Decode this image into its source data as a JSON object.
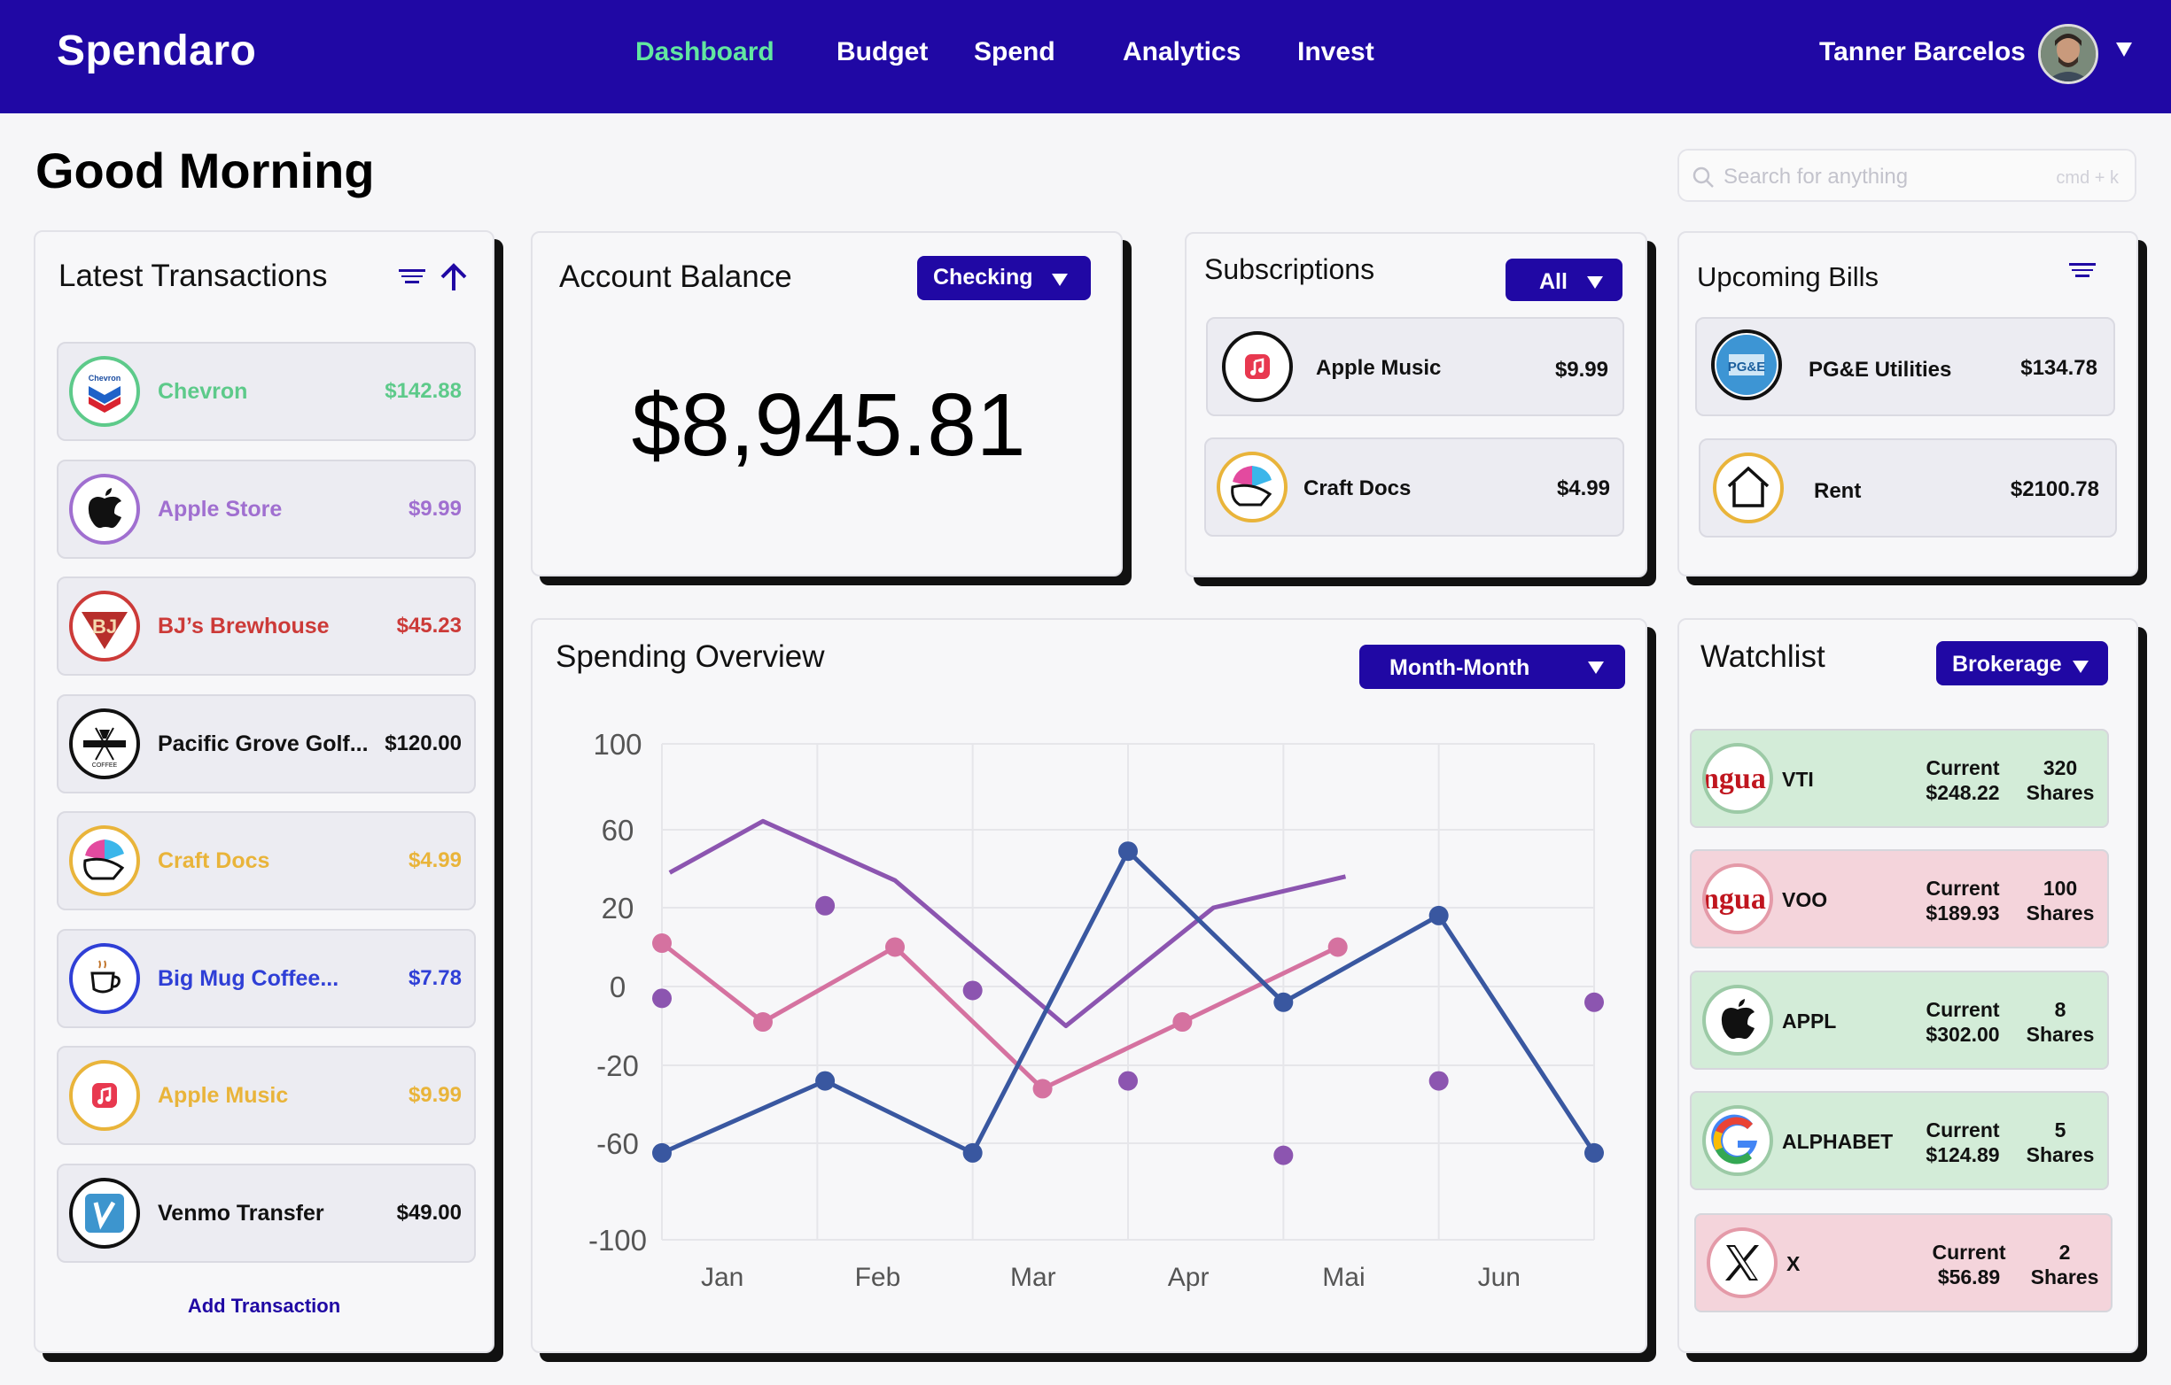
{
  "app": {
    "brand": "Spendaro"
  },
  "nav": [
    {
      "label": "Dashboard",
      "active": true
    },
    {
      "label": "Budget",
      "active": false
    },
    {
      "label": "Spend",
      "active": false
    },
    {
      "label": "Analytics",
      "active": false
    },
    {
      "label": "Invest",
      "active": false
    }
  ],
  "user": {
    "name": "Tanner Barcelos"
  },
  "greeting": "Good Morning",
  "search": {
    "placeholder": "Search for anything",
    "shortcut": "cmd + k"
  },
  "colors": {
    "brand": "#2008a4",
    "active_nav": "#62e6a0",
    "page_bg": "#f6f6f8"
  },
  "transactions": {
    "title": "Latest Transactions",
    "add_label": "Add Transaction",
    "items": [
      {
        "name": "Chevron",
        "amount": "$142.88",
        "color": "#5dca8a",
        "icon": "chevron-logo"
      },
      {
        "name": "Apple Store",
        "amount": "$9.99",
        "color": "#a06fd0",
        "icon": "apple-logo"
      },
      {
        "name": "BJ’s Brewhouse",
        "amount": "$45.23",
        "color": "#cc3a38",
        "icon": "bjs-logo"
      },
      {
        "name": "Pacific Grove Golf...",
        "amount": "$120.00",
        "color": "#111111",
        "icon": "golf-logo"
      },
      {
        "name": "Craft Docs",
        "amount": "$4.99",
        "color": "#e9b43a",
        "icon": "craft-docs-logo"
      },
      {
        "name": "Big Mug Coffee...",
        "amount": "$7.78",
        "color": "#2f3fd6",
        "icon": "coffee-logo"
      },
      {
        "name": "Apple Music",
        "amount": "$9.99",
        "color": "#e9b43a",
        "icon": "apple-music-logo"
      },
      {
        "name": "Venmo Transfer",
        "amount": "$49.00",
        "color": "#111111",
        "icon": "venmo-logo"
      }
    ]
  },
  "balance": {
    "title": "Account Balance",
    "account": "Checking",
    "amount": "$8,945.81"
  },
  "subscriptions": {
    "title": "Subscriptions",
    "filter": "All",
    "items": [
      {
        "name": "Apple Music",
        "amount": "$9.99",
        "icon": "apple-music-logo"
      },
      {
        "name": "Craft Docs",
        "amount": "$4.99",
        "icon": "craft-docs-logo"
      }
    ]
  },
  "bills": {
    "title": "Upcoming Bills",
    "items": [
      {
        "name": "PG&E Utilities",
        "amount": "$134.78",
        "icon": "pge-logo"
      },
      {
        "name": "Rent",
        "amount": "$2100.78",
        "icon": "house-icon"
      }
    ]
  },
  "spending": {
    "title": "Spending Overview",
    "period": "Month-Month"
  },
  "watchlist": {
    "title": "Watchlist",
    "account": "Brokerage",
    "current_label": "Current",
    "shares_label": "Shares",
    "items": [
      {
        "symbol": "VTI",
        "price": "$248.22",
        "shares": "320",
        "status": "up",
        "icon": "vanguard-logo",
        "logo_text": "ngua"
      },
      {
        "symbol": "VOO",
        "price": "$189.93",
        "shares": "100",
        "status": "down",
        "icon": "vanguard-logo",
        "logo_text": "ngua"
      },
      {
        "symbol": "APPL",
        "price": "$302.00",
        "shares": "8",
        "status": "up",
        "icon": "apple-logo"
      },
      {
        "symbol": "ALPHABET",
        "price": "$124.89",
        "shares": "5",
        "status": "up",
        "icon": "google-logo"
      },
      {
        "symbol": "X",
        "price": "$56.89",
        "shares": "2",
        "status": "down",
        "icon": "x-logo"
      }
    ]
  },
  "chart_data": {
    "type": "line",
    "categories": [
      "Jan",
      "Feb",
      "Mar",
      "Apr",
      "Mai",
      "Jun"
    ],
    "y_ticks": [
      100,
      60,
      20,
      0,
      -20,
      -60,
      -100
    ],
    "grid": true,
    "series": [
      {
        "color": "#8c55b0",
        "style": "line",
        "points": [
          [
            0.05,
            38
          ],
          [
            0.65,
            64
          ],
          [
            1.5,
            34
          ],
          [
            2.6,
            -10
          ],
          [
            3.55,
            20
          ],
          [
            4.4,
            36
          ]
        ]
      },
      {
        "color": "#d572a0",
        "style": "line-markers",
        "points": [
          [
            0.0,
            11
          ],
          [
            0.65,
            -9
          ],
          [
            1.5,
            10
          ],
          [
            2.45,
            -32
          ],
          [
            3.35,
            -9
          ],
          [
            4.35,
            10
          ]
        ]
      },
      {
        "color": "#3957a0",
        "style": "line-markers",
        "points": [
          [
            0.0,
            -64
          ],
          [
            1.05,
            -28
          ],
          [
            2.0,
            -64
          ],
          [
            3.0,
            49
          ],
          [
            4.0,
            -4
          ],
          [
            5.0,
            18
          ],
          [
            6.0,
            -64
          ]
        ]
      },
      {
        "color": "#8c55b0",
        "style": "markers",
        "points": [
          [
            0.0,
            -3
          ],
          [
            1.05,
            21
          ],
          [
            2.0,
            -1
          ],
          [
            3.0,
            -28
          ],
          [
            4.0,
            -65
          ],
          [
            5.0,
            -28
          ],
          [
            6.0,
            -4
          ]
        ]
      }
    ]
  }
}
